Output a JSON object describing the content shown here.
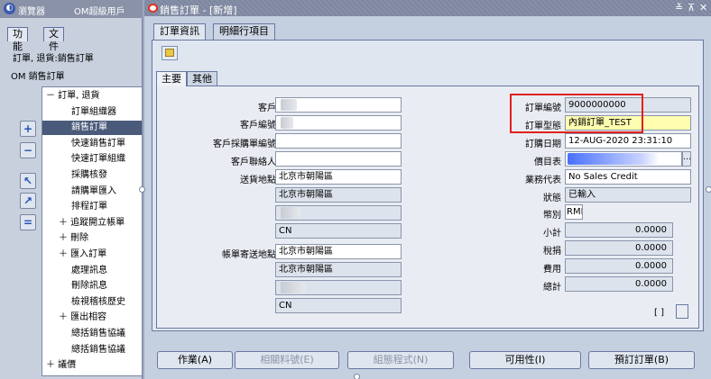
{
  "navigator": {
    "title": "瀏覽器",
    "user_suffix": "OM超級用戶",
    "tabs": [
      "功能",
      "文件"
    ],
    "path_line": "訂單, 退貨:銷售訂單",
    "resp_line": "OM 銷售訂單",
    "tree": [
      {
        "label": "－ 訂單, 退貨",
        "indent": 0,
        "selected": false
      },
      {
        "label": "訂單組織器",
        "indent": 2,
        "selected": false
      },
      {
        "label": "銷售訂單",
        "indent": 2,
        "selected": true
      },
      {
        "label": "快速銷售訂單",
        "indent": 2,
        "selected": false
      },
      {
        "label": "快速訂單組織",
        "indent": 2,
        "selected": false
      },
      {
        "label": "採購核發",
        "indent": 2,
        "selected": false
      },
      {
        "label": "請購單匯入",
        "indent": 2,
        "selected": false
      },
      {
        "label": "排程訂單",
        "indent": 2,
        "selected": false
      },
      {
        "label": "＋ 追蹤開立帳單",
        "indent": 1,
        "selected": false
      },
      {
        "label": "＋ 刪除",
        "indent": 1,
        "selected": false
      },
      {
        "label": "＋ 匯入訂單",
        "indent": 1,
        "selected": false
      },
      {
        "label": "處理訊息",
        "indent": 2,
        "selected": false
      },
      {
        "label": "刪除訊息",
        "indent": 2,
        "selected": false
      },
      {
        "label": "檢視稽核歷史",
        "indent": 2,
        "selected": false
      },
      {
        "label": "＋ 匯出相容",
        "indent": 1,
        "selected": false
      },
      {
        "label": "總括銷售協議",
        "indent": 2,
        "selected": false
      },
      {
        "label": "總括銷售協議",
        "indent": 2,
        "selected": false
      },
      {
        "label": "＋ 議價",
        "indent": 0,
        "selected": false
      }
    ],
    "side_buttons": [
      "plus-icon",
      "minus-icon",
      "add-to-top-icon",
      "add-all-icon",
      "remove-icon"
    ]
  },
  "order_window": {
    "title": "銷售訂單 - [新增]",
    "window_controls": [
      "≚",
      "⊼",
      "✕"
    ],
    "main_tabs": [
      "訂單資訊",
      "明細行項目"
    ],
    "sub_tabs": [
      "主要",
      "其他"
    ],
    "left_fields": {
      "customer_label": "客戶",
      "customer_no_label": "客戶編號",
      "customer_po_label": "客戶採購單編號",
      "customer_contact_label": "客戶聯絡人",
      "ship_to_label": "送貨地點",
      "ship_to_line1": "北京市朝陽區",
      "ship_to_line2": "北京市朝陽區",
      "ship_to_country": "CN",
      "bill_to_label": "帳單寄送地點",
      "bill_to_line1": "北京市朝陽區",
      "bill_to_line2": "北京市朝陽區",
      "bill_to_country": "CN"
    },
    "right_fields": {
      "order_no_label": "訂單編號",
      "order_no": "9000000000",
      "order_type_label": "訂單型態",
      "order_type": "內銷訂單_TEST",
      "order_date_label": "訂購日期",
      "order_date": "12-AUG-2020 23:31:10",
      "price_list_label": "價目表",
      "salesperson_label": "業務代表",
      "salesperson": "No Sales Credit",
      "status_label": "狀態",
      "status": "已輸入",
      "currency_label": "幣別",
      "currency": "RMB",
      "subtotal_label": "小計",
      "subtotal": "0.0000",
      "tax_label": "稅捐",
      "tax": "0.0000",
      "charges_label": "費用",
      "charges": "0.0000",
      "total_label": "總計",
      "total": "0.0000"
    },
    "bracket_text": "[ ]",
    "buttons": [
      {
        "label": "作業(A)",
        "enabled": true
      },
      {
        "label": "相關料號(E)",
        "enabled": false
      },
      {
        "label": "組態程式(N)",
        "enabled": false
      },
      {
        "label": "可用性(I)",
        "enabled": true
      },
      {
        "label": "預訂訂單(B)",
        "enabled": true
      }
    ]
  },
  "colors": {
    "highlight": "#e0201a",
    "order_type_bg": "#fffdb0",
    "selected_tree": "#4a5a7a"
  }
}
